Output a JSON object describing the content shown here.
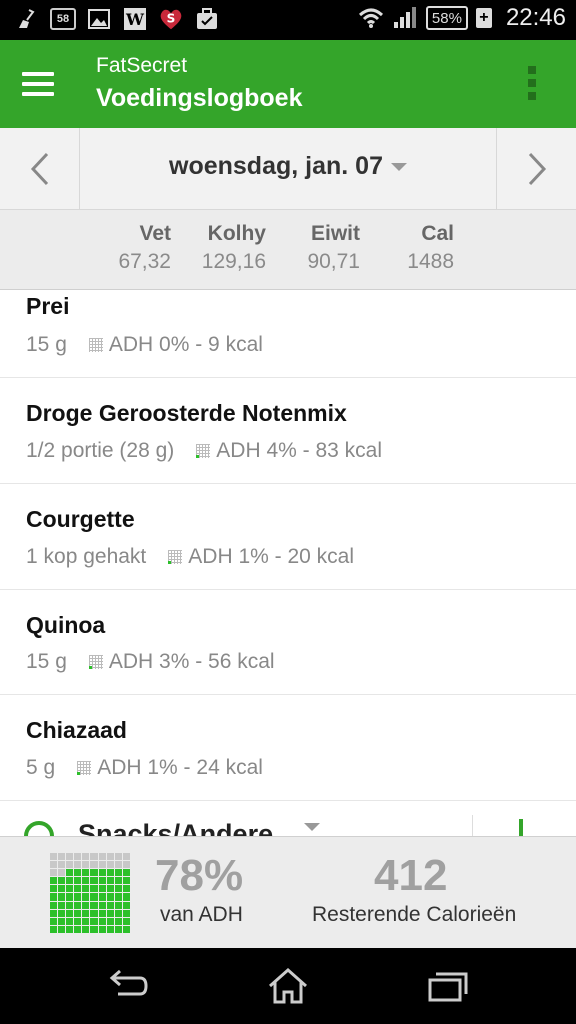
{
  "status_bar": {
    "notification_count": "58",
    "battery": "58%",
    "time": "22:46",
    "icons": [
      "broom-icon",
      "message-count-icon",
      "image-icon",
      "w-app-icon",
      "heart-s-icon",
      "briefcase-icon",
      "wifi-icon",
      "signal-icon",
      "battery-icon",
      "charging-plus-icon"
    ]
  },
  "app_bar": {
    "app_name": "FatSecret",
    "title": "Voedingslogboek",
    "icons": [
      "menu-icon",
      "overflow-menu-icon"
    ]
  },
  "date_nav": {
    "date": "woensdag, jan. 07",
    "icons": [
      "chevron-left-icon",
      "dropdown-caret-icon",
      "chevron-right-icon"
    ]
  },
  "totals": {
    "columns": [
      {
        "label": "Vet",
        "value": "67,32"
      },
      {
        "label": "Kolhy",
        "value": "129,16"
      },
      {
        "label": "Eiwit",
        "value": "90,71"
      },
      {
        "label": "Cal",
        "value": "1488"
      }
    ]
  },
  "food_items": [
    {
      "name": "Prei",
      "amount": "15 g",
      "rdi": "ADH 0% - 9 kcal"
    },
    {
      "name": "Droge Geroosterde Notenmix",
      "amount": "1/2 portie (28 g)",
      "rdi": "ADH 4% - 83 kcal"
    },
    {
      "name": "Courgette",
      "amount": "1 kop gehakt",
      "rdi": "ADH 1% - 20 kcal"
    },
    {
      "name": "Quinoa",
      "amount": "15 g",
      "rdi": "ADH 3% - 56 kcal"
    },
    {
      "name": "Chiazaad",
      "amount": "5 g",
      "rdi": "ADH 1% - 24 kcal"
    }
  ],
  "next_section": {
    "title": "Snacks/Andere"
  },
  "summary": {
    "percent": "78%",
    "percent_label": "van ADH",
    "percent_fill": 0.78,
    "remaining": "412",
    "remaining_label": "Resterende Calorieën",
    "accent_color": "#2cc02a"
  },
  "colors": {
    "brand_green": "#34a52a"
  },
  "nav_bar": {
    "icons": [
      "back-icon",
      "home-icon",
      "recent-apps-icon"
    ]
  }
}
